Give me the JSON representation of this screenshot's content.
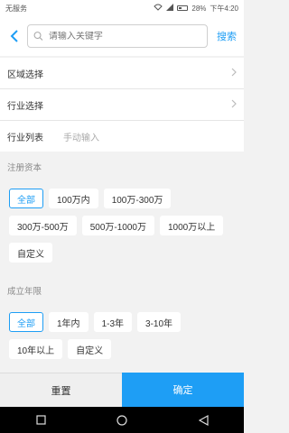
{
  "status": {
    "carrier": "无服务",
    "battery": "28%",
    "time": "下午4:20"
  },
  "header": {
    "back_icon": "chevron-left-icon",
    "search_placeholder": "请输入关键字",
    "search_button": "搜索"
  },
  "rows": {
    "region": {
      "label": "区域选择"
    },
    "industry": {
      "label": "行业选择"
    },
    "industry_list": {
      "label": "行业列表",
      "placeholder": "手动输入"
    }
  },
  "capital": {
    "title": "注册资本",
    "options": [
      "全部",
      "100万内",
      "100万-300万",
      "300万-500万",
      "500万-1000万",
      "1000万以上",
      "自定义"
    ],
    "selected": "全部"
  },
  "founding": {
    "title": "成立年限",
    "options": [
      "全部",
      "1年内",
      "1-3年",
      "3-10年",
      "10年以上",
      "自定义"
    ],
    "selected": "全部"
  },
  "actions": {
    "reset": "重置",
    "confirm": "确定"
  },
  "colors": {
    "accent": "#1e9ef5"
  }
}
